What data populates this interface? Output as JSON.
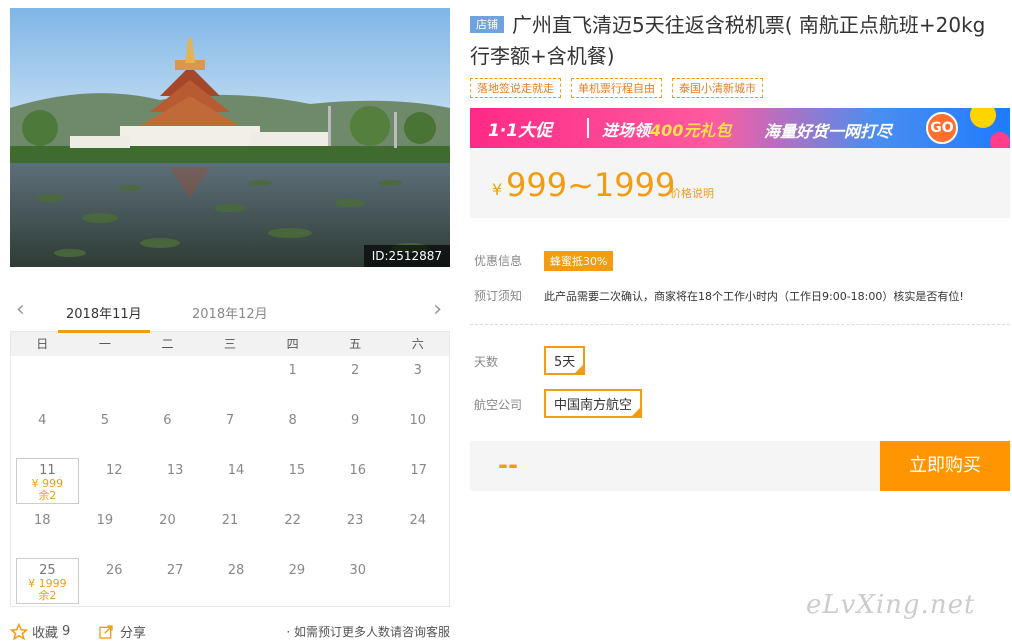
{
  "photo": {
    "id_label": "ID:2512887"
  },
  "product": {
    "shop_tag": "店铺",
    "title": "广州直飞清迈5天往返含税机票( 南航正点航班+20kg行李额+含机餐)",
    "tags": [
      "落地签说走就走",
      "单机票行程自由",
      "泰国小清新城市"
    ]
  },
  "banner": {
    "promo": "1·1大促",
    "part1": "进场领",
    "highlight": "400元礼包",
    "part2": "海量好货一网打尽",
    "go": "GO"
  },
  "price": {
    "currency": "¥",
    "range": "999~1999",
    "explain": "价格说明"
  },
  "info": {
    "discount_label": "优惠信息",
    "discount_value": "蜂蜜抵30%",
    "notice_label": "预订须知",
    "notice_value": "此产品需要二次确认，商家将在18个工作小时内（工作日9:00-18:00）核实是否有位!"
  },
  "options": {
    "days_label": "天数",
    "days_value": "5天",
    "airline_label": "航空公司",
    "airline_value": "中国南方航空"
  },
  "buy": {
    "placeholder_price": "--",
    "button": "立即购买"
  },
  "calendar": {
    "tabs": [
      "2018年11月",
      "2018年12月"
    ],
    "weekdays": [
      "日",
      "一",
      "二",
      "三",
      "四",
      "五",
      "六"
    ],
    "rows": [
      [
        {
          "d": ""
        },
        {
          "d": ""
        },
        {
          "d": ""
        },
        {
          "d": ""
        },
        {
          "d": "1"
        },
        {
          "d": "2"
        },
        {
          "d": "3"
        }
      ],
      [
        {
          "d": "4"
        },
        {
          "d": "5"
        },
        {
          "d": "6"
        },
        {
          "d": "7"
        },
        {
          "d": "8"
        },
        {
          "d": "9"
        },
        {
          "d": "10"
        }
      ],
      [
        {
          "d": "11",
          "price": "¥ 999",
          "stock": "余2"
        },
        {
          "d": "12"
        },
        {
          "d": "13"
        },
        {
          "d": "14"
        },
        {
          "d": "15"
        },
        {
          "d": "16"
        },
        {
          "d": "17"
        }
      ],
      [
        {
          "d": "18"
        },
        {
          "d": "19"
        },
        {
          "d": "20"
        },
        {
          "d": "21"
        },
        {
          "d": "22"
        },
        {
          "d": "23"
        },
        {
          "d": "24"
        }
      ],
      [
        {
          "d": "25",
          "price": "¥ 1999",
          "stock": "余2"
        },
        {
          "d": "26"
        },
        {
          "d": "27"
        },
        {
          "d": "28"
        },
        {
          "d": "29"
        },
        {
          "d": "30"
        },
        {
          "d": ""
        }
      ]
    ]
  },
  "footer": {
    "fav_label": "收藏",
    "fav_count": "9",
    "share_label": "分享",
    "note": "· 如需预订更多人数请咨询客服"
  },
  "watermark": "eLvXing.net",
  "colors": {
    "accent": "#f39c12",
    "buy": "#ff9500",
    "shop_tag": "#6fa3e0"
  }
}
